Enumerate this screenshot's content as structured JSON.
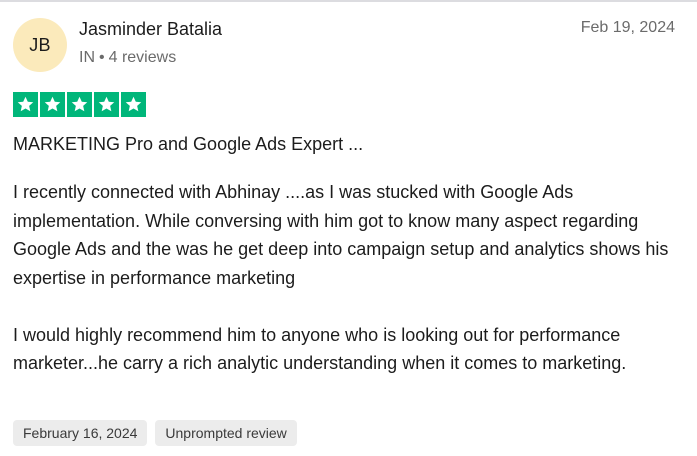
{
  "reviewer": {
    "initials": "JB",
    "name": "Jasminder Batalia",
    "country": "IN",
    "separator": "•",
    "reviews_count": "4 reviews",
    "avatar_color": "#fbeabb"
  },
  "review": {
    "date": "Feb 19, 2024",
    "rating": 5,
    "rating_max": 5,
    "star_color": "#00b67a",
    "star_icon": "star-icon",
    "title": "MARKETING Pro and Google Ads Expert ...",
    "paragraphs": [
      "I recently connected with Abhinay ....as I was stucked with Google Ads implementation. While conversing with him got to know many aspect regarding Google Ads and the was he get deep into campaign setup and analytics shows his expertise in performance marketing",
      "I would highly recommend him to anyone who is looking out for performance marketer...he carry a rich analytic understanding when it comes to marketing."
    ],
    "tags": [
      "February 16, 2024",
      "Unprompted review"
    ]
  }
}
